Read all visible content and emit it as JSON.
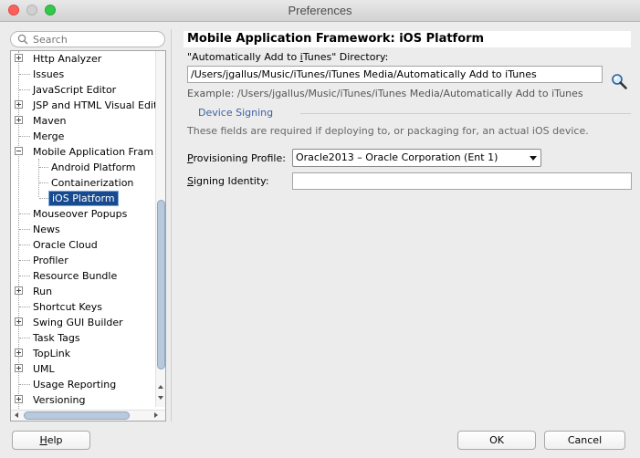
{
  "window": {
    "title": "Preferences"
  },
  "search": {
    "placeholder": "Search"
  },
  "tree": {
    "items": [
      {
        "label": "Http Analyzer",
        "expander": "plus",
        "level": 0
      },
      {
        "label": "Issues",
        "expander": "none",
        "level": 0
      },
      {
        "label": "JavaScript Editor",
        "expander": "none",
        "level": 0
      },
      {
        "label": "JSP and HTML Visual Edit",
        "expander": "plus",
        "level": 0
      },
      {
        "label": "Maven",
        "expander": "plus",
        "level": 0
      },
      {
        "label": "Merge",
        "expander": "none",
        "level": 0
      },
      {
        "label": "Mobile Application Fram",
        "expander": "minus",
        "level": 0
      },
      {
        "label": "Android Platform",
        "expander": "none",
        "level": 1
      },
      {
        "label": "Containerization",
        "expander": "none",
        "level": 1
      },
      {
        "label": "iOS Platform",
        "expander": "none",
        "level": 1,
        "selected": true
      },
      {
        "label": "Mouseover Popups",
        "expander": "none",
        "level": 0
      },
      {
        "label": "News",
        "expander": "none",
        "level": 0
      },
      {
        "label": "Oracle Cloud",
        "expander": "none",
        "level": 0
      },
      {
        "label": "Profiler",
        "expander": "none",
        "level": 0
      },
      {
        "label": "Resource Bundle",
        "expander": "none",
        "level": 0
      },
      {
        "label": "Run",
        "expander": "plus",
        "level": 0
      },
      {
        "label": "Shortcut Keys",
        "expander": "none",
        "level": 0
      },
      {
        "label": "Swing GUI Builder",
        "expander": "plus",
        "level": 0
      },
      {
        "label": "Task Tags",
        "expander": "none",
        "level": 0
      },
      {
        "label": "TopLink",
        "expander": "plus",
        "level": 0
      },
      {
        "label": "UML",
        "expander": "plus",
        "level": 0
      },
      {
        "label": "Usage Reporting",
        "expander": "none",
        "level": 0
      },
      {
        "label": "Versioning",
        "expander": "plus",
        "level": 0
      }
    ]
  },
  "panel": {
    "title": "Mobile Application Framework: iOS Platform",
    "itunes_dir": {
      "label_pre": "\"Automatically Add to ",
      "label_mnemonic": "i",
      "label_post": "Tunes\" Directory:",
      "value": "/Users/jgallus/Music/iTunes/iTunes Media/Automatically Add to iTunes",
      "example": "Example: /Users/jgallus/Music/iTunes/iTunes Media/Automatically Add to iTunes"
    },
    "device_signing": {
      "title": "Device Signing",
      "note": "These fields are required if deploying to, or packaging for, an actual iOS device.",
      "provisioning_label_mnemonic": "P",
      "provisioning_label_rest": "rovisioning Profile:",
      "provisioning_value": "Oracle2013  –  Oracle Corporation (Ent 1)",
      "identity_label_mnemonic": "S",
      "identity_label_rest": "igning Identity:",
      "identity_value": ""
    }
  },
  "buttons": {
    "help_mnemonic": "H",
    "help_rest": "elp",
    "ok": "OK",
    "cancel": "Cancel"
  },
  "colors": {
    "selection": "#184a8f",
    "section_title": "#3b62a3"
  }
}
